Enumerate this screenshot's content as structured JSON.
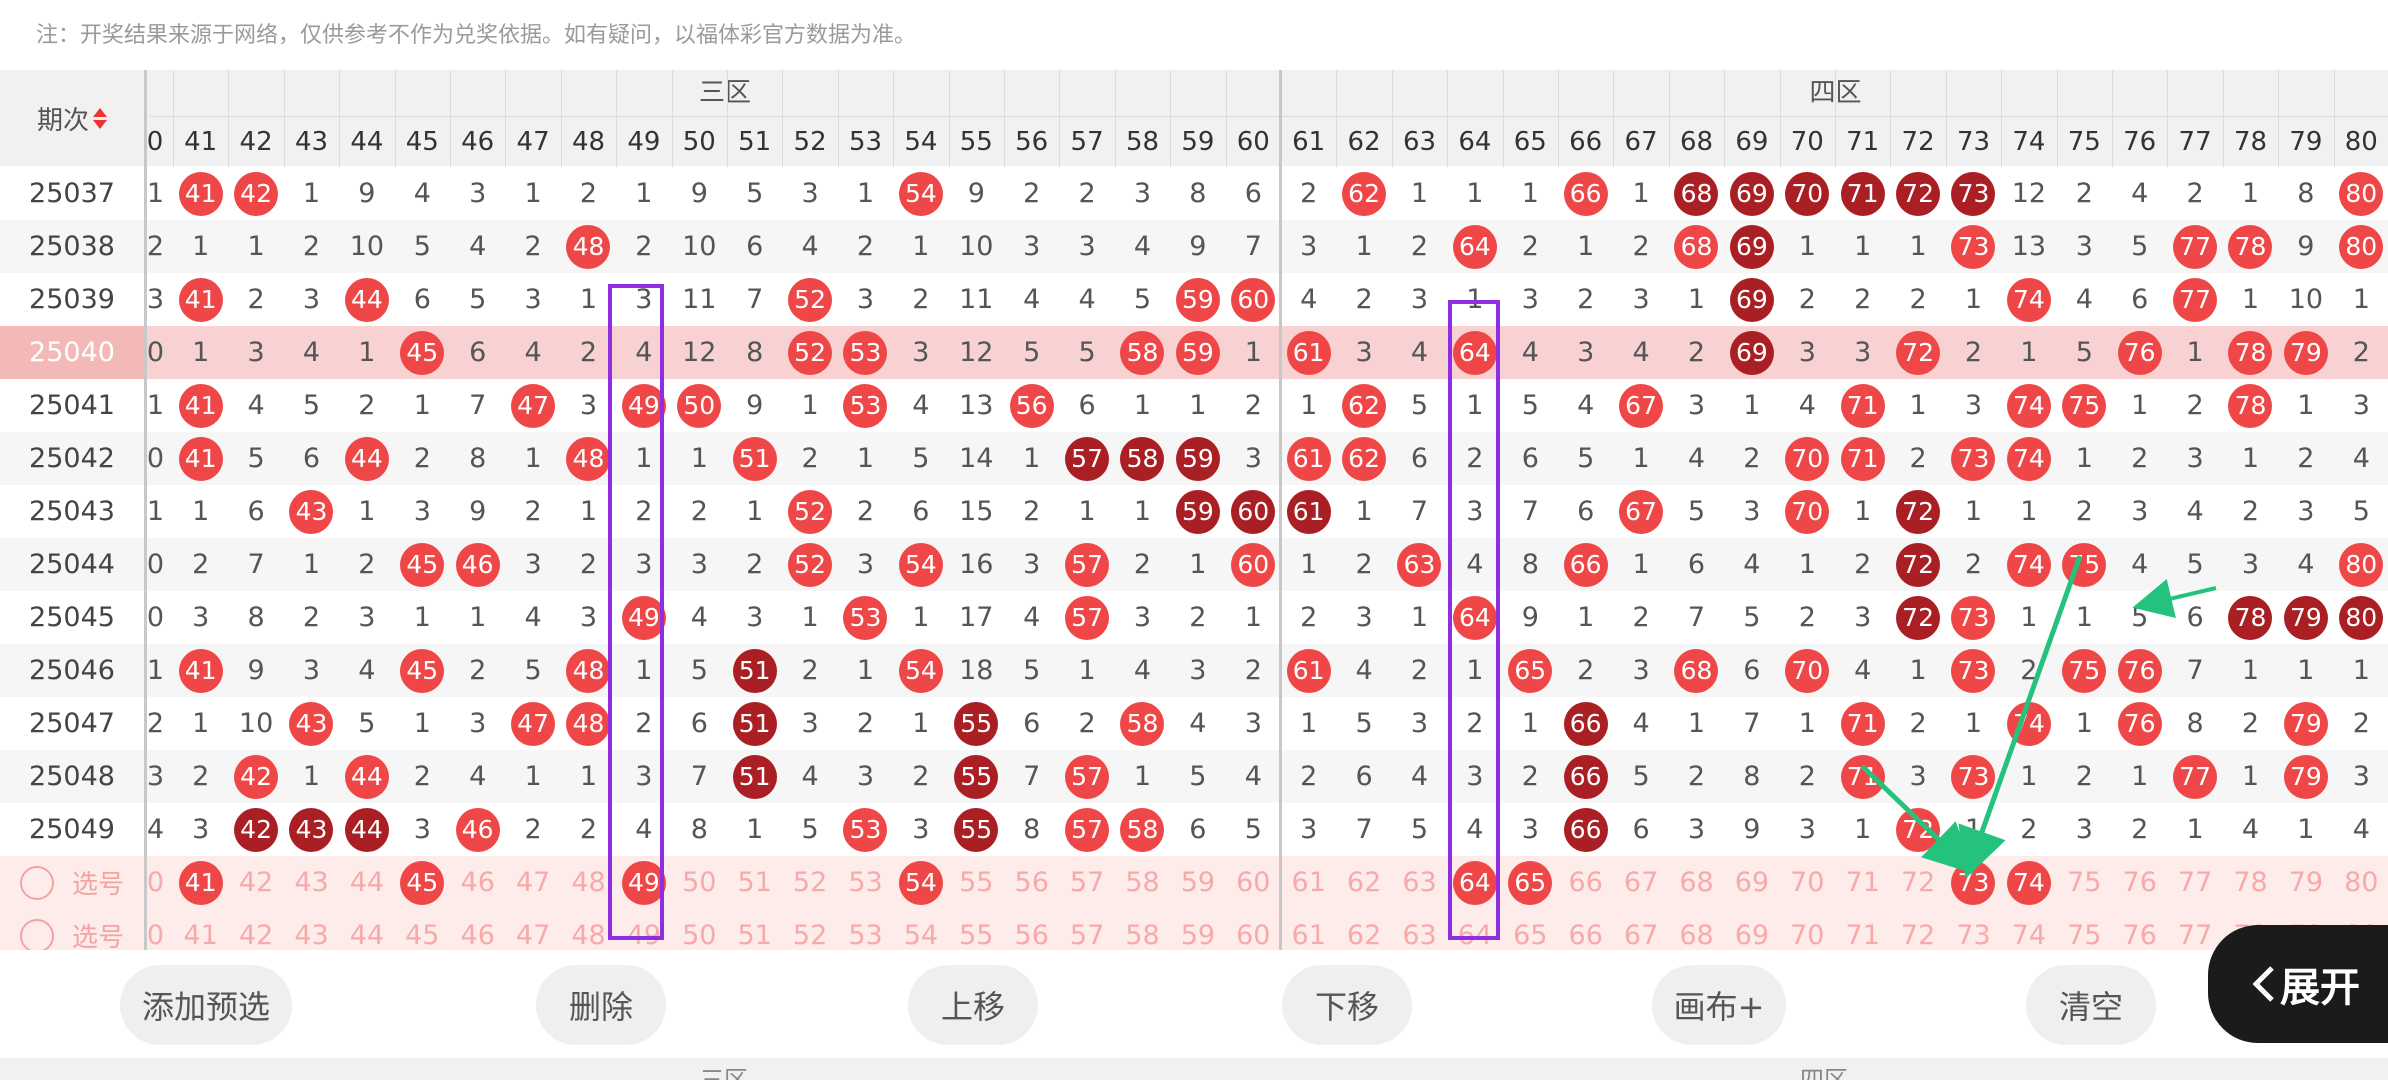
{
  "notice": "注：开奖结果来源于网络，仅供参考不作为兑奖依据。如有疑问，以福体彩官方数据为准。",
  "header": {
    "issue_label": "期次",
    "zone3": "三区",
    "zone4": "四区",
    "partial_col": "0",
    "columns": [
      "41",
      "42",
      "43",
      "44",
      "45",
      "46",
      "47",
      "48",
      "49",
      "50",
      "51",
      "52",
      "53",
      "54",
      "55",
      "56",
      "57",
      "58",
      "59",
      "60",
      "61",
      "62",
      "63",
      "64",
      "65",
      "66",
      "67",
      "68",
      "69",
      "70",
      "71",
      "72",
      "73",
      "74",
      "75",
      "76",
      "77",
      "78",
      "79",
      "80"
    ]
  },
  "rows": [
    {
      "issue": "25037",
      "partial": "1",
      "cells": [
        "b41",
        "b42",
        "1",
        "9",
        "4",
        "3",
        "1",
        "2",
        "1",
        "9",
        "5",
        "3",
        "1",
        "b54",
        "9",
        "2",
        "2",
        "3",
        "8",
        "6",
        "2",
        "b62",
        "1",
        "1",
        "1",
        "b66",
        "1",
        "d68",
        "d69",
        "d70",
        "d71",
        "d72",
        "d73",
        "12",
        "2",
        "4",
        "2",
        "1",
        "8",
        "b80"
      ]
    },
    {
      "issue": "25038",
      "partial": "2",
      "cells": [
        "1",
        "1",
        "2",
        "10",
        "5",
        "4",
        "2",
        "b48",
        "2",
        "10",
        "6",
        "4",
        "2",
        "1",
        "10",
        "3",
        "3",
        "4",
        "9",
        "7",
        "3",
        "1",
        "2",
        "b64",
        "2",
        "1",
        "2",
        "b68",
        "d69",
        "1",
        "1",
        "1",
        "b73",
        "13",
        "3",
        "5",
        "b77",
        "b78",
        "9",
        "b80"
      ]
    },
    {
      "issue": "25039",
      "partial": "3",
      "cells": [
        "b41",
        "2",
        "3",
        "b44",
        "6",
        "5",
        "3",
        "1",
        "3",
        "11",
        "7",
        "b52",
        "3",
        "2",
        "11",
        "4",
        "4",
        "5",
        "b59",
        "b60",
        "4",
        "2",
        "3",
        "1",
        "3",
        "2",
        "3",
        "1",
        "d69",
        "2",
        "2",
        "2",
        "1",
        "b74",
        "4",
        "6",
        "b77",
        "1",
        "10",
        "1"
      ]
    },
    {
      "issue": "25040",
      "partial": "0",
      "cells": [
        "1",
        "3",
        "4",
        "1",
        "b45",
        "6",
        "4",
        "2",
        "4",
        "12",
        "8",
        "b52",
        "b53",
        "3",
        "12",
        "5",
        "5",
        "b58",
        "b59",
        "1",
        "b61",
        "3",
        "4",
        "b64",
        "4",
        "3",
        "4",
        "2",
        "d69",
        "3",
        "3",
        "b72",
        "2",
        "1",
        "5",
        "b76",
        "1",
        "b78",
        "b79",
        "2"
      ]
    },
    {
      "issue": "25041",
      "partial": "1",
      "cells": [
        "b41",
        "4",
        "5",
        "2",
        "1",
        "7",
        "b47",
        "3",
        "b49",
        "b50",
        "9",
        "1",
        "b53",
        "4",
        "13",
        "b56",
        "6",
        "1",
        "1",
        "2",
        "1",
        "b62",
        "5",
        "1",
        "5",
        "4",
        "b67",
        "3",
        "1",
        "4",
        "b71",
        "1",
        "3",
        "b74",
        "b75",
        "1",
        "2",
        "b78",
        "1",
        "3"
      ]
    },
    {
      "issue": "25042",
      "partial": "0",
      "cells": [
        "b41",
        "5",
        "6",
        "b44",
        "2",
        "8",
        "1",
        "b48",
        "1",
        "1",
        "b51",
        "2",
        "1",
        "5",
        "14",
        "1",
        "d57",
        "d58",
        "d59",
        "3",
        "b61",
        "b62",
        "6",
        "2",
        "6",
        "5",
        "1",
        "4",
        "2",
        "b70",
        "b71",
        "2",
        "b73",
        "b74",
        "1",
        "2",
        "3",
        "1",
        "2",
        "4"
      ]
    },
    {
      "issue": "25043",
      "partial": "1",
      "cells": [
        "1",
        "6",
        "b43",
        "1",
        "3",
        "9",
        "2",
        "1",
        "2",
        "2",
        "1",
        "b52",
        "2",
        "6",
        "15",
        "2",
        "1",
        "1",
        "d59",
        "d60",
        "d61",
        "1",
        "7",
        "3",
        "7",
        "6",
        "b67",
        "5",
        "3",
        "b70",
        "1",
        "d72",
        "1",
        "1",
        "2",
        "3",
        "4",
        "2",
        "3",
        "5"
      ]
    },
    {
      "issue": "25044",
      "partial": "0",
      "cells": [
        "2",
        "7",
        "1",
        "2",
        "b45",
        "b46",
        "3",
        "2",
        "3",
        "3",
        "2",
        "b52",
        "3",
        "b54",
        "16",
        "3",
        "b57",
        "2",
        "1",
        "b60",
        "1",
        "2",
        "b63",
        "4",
        "8",
        "b66",
        "1",
        "6",
        "4",
        "1",
        "2",
        "d72",
        "2",
        "b74",
        "b75",
        "4",
        "5",
        "3",
        "4",
        "b80"
      ]
    },
    {
      "issue": "25045",
      "partial": "0",
      "cells": [
        "3",
        "8",
        "2",
        "3",
        "1",
        "1",
        "4",
        "3",
        "b49",
        "4",
        "3",
        "1",
        "b53",
        "1",
        "17",
        "4",
        "b57",
        "3",
        "2",
        "1",
        "2",
        "3",
        "1",
        "b64",
        "9",
        "1",
        "2",
        "7",
        "5",
        "2",
        "3",
        "d72",
        "b73",
        "1",
        "1",
        "5",
        "6",
        "d78",
        "d79",
        "d80"
      ]
    },
    {
      "issue": "25046",
      "partial": "1",
      "cells": [
        "b41",
        "9",
        "3",
        "4",
        "b45",
        "2",
        "5",
        "b48",
        "1",
        "5",
        "d51",
        "2",
        "1",
        "b54",
        "18",
        "5",
        "1",
        "4",
        "3",
        "2",
        "b61",
        "4",
        "2",
        "1",
        "b65",
        "2",
        "3",
        "b68",
        "6",
        "b70",
        "4",
        "1",
        "b73",
        "2",
        "b75",
        "b76",
        "7",
        "1",
        "1",
        "1"
      ]
    },
    {
      "issue": "25047",
      "partial": "2",
      "cells": [
        "1",
        "10",
        "b43",
        "5",
        "1",
        "3",
        "b47",
        "b48",
        "2",
        "6",
        "d51",
        "3",
        "2",
        "1",
        "d55",
        "6",
        "2",
        "b58",
        "4",
        "3",
        "1",
        "5",
        "3",
        "2",
        "1",
        "d66",
        "4",
        "1",
        "7",
        "1",
        "b71",
        "2",
        "1",
        "b74",
        "1",
        "b76",
        "8",
        "2",
        "b79",
        "2"
      ]
    },
    {
      "issue": "25048",
      "partial": "3",
      "cells": [
        "2",
        "b42",
        "1",
        "b44",
        "2",
        "4",
        "1",
        "1",
        "3",
        "7",
        "d51",
        "4",
        "3",
        "2",
        "d55",
        "7",
        "b57",
        "1",
        "5",
        "4",
        "2",
        "6",
        "4",
        "3",
        "2",
        "d66",
        "5",
        "2",
        "8",
        "2",
        "b71",
        "3",
        "b73",
        "1",
        "2",
        "1",
        "b77",
        "1",
        "b79",
        "3"
      ]
    },
    {
      "issue": "25049",
      "partial": "4",
      "cells": [
        "3",
        "d42",
        "d43",
        "d44",
        "3",
        "b46",
        "2",
        "2",
        "4",
        "8",
        "1",
        "5",
        "b53",
        "3",
        "d55",
        "8",
        "b57",
        "b58",
        "6",
        "5",
        "3",
        "7",
        "5",
        "4",
        "3",
        "d66",
        "6",
        "3",
        "9",
        "3",
        "1",
        "b72",
        "1",
        "2",
        "3",
        "2",
        "1",
        "4",
        "1",
        "4"
      ]
    }
  ],
  "select_rows": [
    {
      "label": "选号",
      "partial": "0",
      "cells": [
        "b41",
        "42",
        "43",
        "44",
        "b45",
        "46",
        "47",
        "48",
        "b49",
        "50",
        "51",
        "52",
        "53",
        "b54",
        "55",
        "56",
        "57",
        "58",
        "59",
        "60",
        "61",
        "62",
        "63",
        "b64",
        "b65",
        "66",
        "67",
        "68",
        "69",
        "70",
        "71",
        "72",
        "b73",
        "b74",
        "75",
        "76",
        "77",
        "78",
        "79",
        "80"
      ]
    },
    {
      "label": "选号",
      "partial": "0",
      "cells": [
        "41",
        "42",
        "43",
        "44",
        "45",
        "46",
        "47",
        "48",
        "49",
        "50",
        "51",
        "52",
        "53",
        "54",
        "55",
        "56",
        "57",
        "58",
        "59",
        "60",
        "61",
        "62",
        "63",
        "64",
        "65",
        "66",
        "67",
        "68",
        "69",
        "70",
        "71",
        "72",
        "73",
        "74",
        "75",
        "76",
        "77",
        "78",
        "79",
        "80"
      ]
    }
  ],
  "buttons": {
    "add_preselect": "添加预选",
    "delete": "删除",
    "move_up": "上移",
    "move_down": "下移",
    "canvas_plus": "画布+",
    "clear": "清空",
    "expand": "展开"
  },
  "bottom": {
    "zone3": "三区",
    "zone4": "四区"
  },
  "colors": {
    "ball_red": "#ef4747",
    "ball_dark": "#a91f24",
    "highlight_row": "#f8d2d2",
    "box": "#8f2de0",
    "arrow": "#25c27d"
  }
}
